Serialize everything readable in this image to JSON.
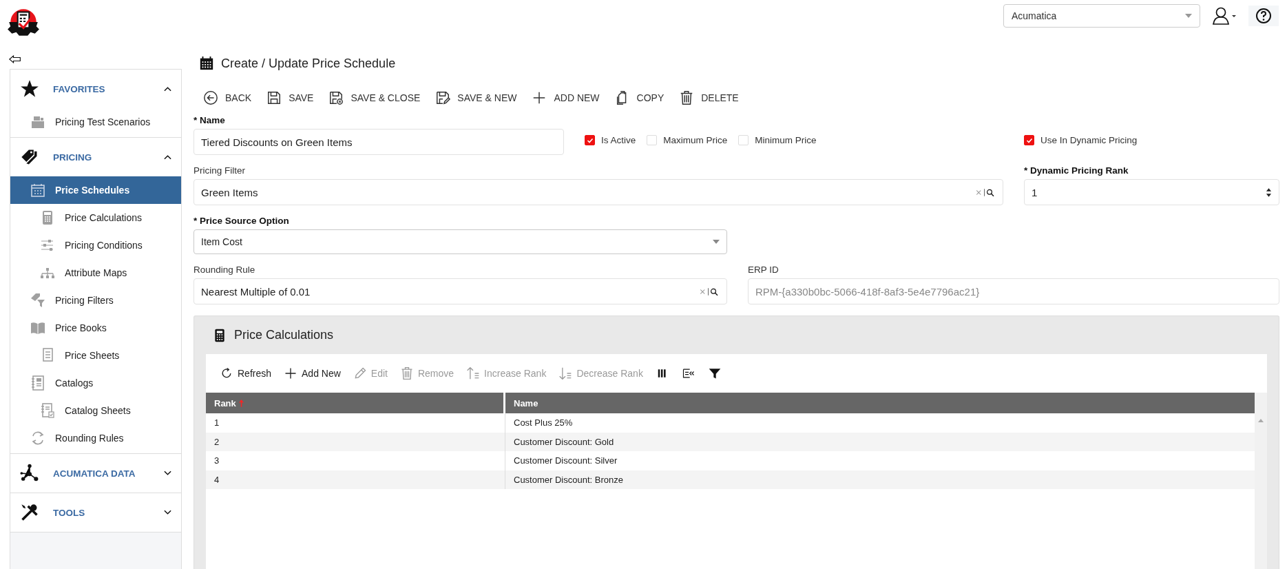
{
  "header": {
    "company": "Acumatica"
  },
  "sidebar": {
    "sections": [
      {
        "label": "FAVORITES",
        "expanded": true,
        "items": [
          {
            "label": "Pricing Test Scenarios",
            "selected": false
          }
        ]
      },
      {
        "label": "PRICING",
        "expanded": true,
        "items": [
          {
            "label": "Price Schedules",
            "selected": true,
            "children": [
              {
                "label": "Price Calculations",
                "selected": false
              },
              {
                "label": "Pricing Conditions",
                "selected": false
              },
              {
                "label": "Attribute Maps",
                "selected": false
              }
            ]
          },
          {
            "label": "Pricing Filters",
            "selected": false
          },
          {
            "label": "Price Books",
            "selected": false,
            "children": [
              {
                "label": "Price Sheets",
                "selected": false
              }
            ]
          },
          {
            "label": "Catalogs",
            "selected": false,
            "children": [
              {
                "label": "Catalog Sheets",
                "selected": false
              }
            ]
          },
          {
            "label": "Rounding Rules",
            "selected": false
          }
        ]
      },
      {
        "label": "ACUMATICA DATA",
        "expanded": false
      },
      {
        "label": "TOOLS",
        "expanded": false
      }
    ]
  },
  "page": {
    "title": "Create / Update Price Schedule"
  },
  "toolbar": [
    "BACK",
    "SAVE",
    "SAVE & CLOSE",
    "SAVE & NEW",
    "ADD NEW",
    "COPY",
    "DELETE"
  ],
  "form": {
    "name": {
      "label": "* Name",
      "value": "Tiered Discounts on Green Items"
    },
    "checkboxes": [
      {
        "label": "Is Active",
        "checked": true
      },
      {
        "label": "Maximum Price",
        "checked": false
      },
      {
        "label": "Minimum Price",
        "checked": false
      }
    ],
    "dynamic_pricing": {
      "label": "Use In Dynamic Pricing",
      "checked": true
    },
    "pricing_filter": {
      "label": "Pricing Filter",
      "value": "Green Items"
    },
    "dynamic_rank": {
      "label": "* Dynamic Pricing Rank",
      "value": "1"
    },
    "price_source": {
      "label": "* Price Source Option",
      "value": "Item Cost"
    },
    "rounding_rule": {
      "label": "Rounding Rule",
      "value": "Nearest Multiple of 0.01"
    },
    "erp_id": {
      "label": "ERP ID",
      "value": "RPM-{a330b0bc-5066-418f-8af3-5e4e7796ac21}",
      "disabled": true
    }
  },
  "calculations": {
    "title": "Price Calculations",
    "toolbar": [
      {
        "label": "Refresh",
        "disabled": false
      },
      {
        "label": "Add New",
        "disabled": false
      },
      {
        "label": "Edit",
        "disabled": true
      },
      {
        "label": "Remove",
        "disabled": true
      },
      {
        "label": "Increase Rank",
        "disabled": true
      },
      {
        "label": "Decrease Rank",
        "disabled": true
      }
    ],
    "columns": [
      {
        "label": "Rank",
        "sorted_ascending": true
      },
      {
        "label": "Name",
        "sorted_ascending": false
      }
    ],
    "rows": [
      {
        "rank": "1",
        "name": "Cost Plus 25%"
      },
      {
        "rank": "2",
        "name": "Customer Discount: Gold"
      },
      {
        "rank": "3",
        "name": "Customer Discount: Silver"
      },
      {
        "rank": "4",
        "name": "Customer Discount: Bronze"
      }
    ]
  }
}
